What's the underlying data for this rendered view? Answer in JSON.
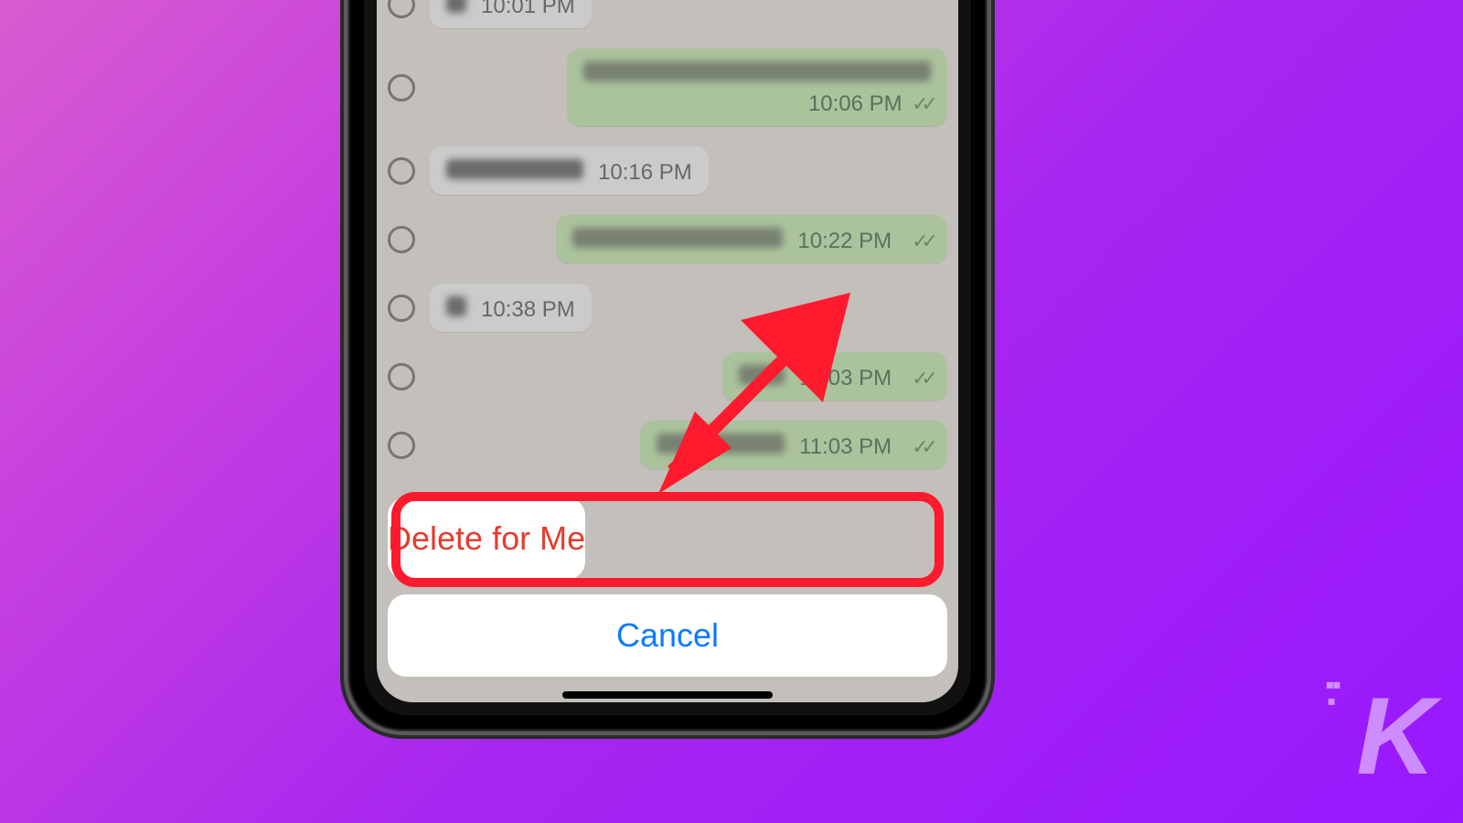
{
  "chat": {
    "messages": [
      {
        "dir": "in",
        "time": "10:01 PM",
        "blur_w": 22
      },
      {
        "dir": "out",
        "time": "10:06 PM",
        "blur_w": 380
      },
      {
        "dir": "in",
        "time": "10:16 PM",
        "blur_w": 150
      },
      {
        "dir": "out",
        "time": "10:22 PM",
        "blur_w": 230
      },
      {
        "dir": "in",
        "time": "10:38 PM",
        "blur_w": 22
      },
      {
        "dir": "out",
        "time": "11:03 PM",
        "blur_w": 50
      },
      {
        "dir": "out",
        "time": "11:03 PM",
        "blur_w": 140
      }
    ]
  },
  "sheet": {
    "delete_label": "Delete for Me",
    "cancel_label": "Cancel"
  },
  "watermark": {
    "letter": "K"
  },
  "colors": {
    "highlight": "#ff1a2e",
    "delete_text": "#e63b2e",
    "cancel_text": "#0a7bff"
  }
}
